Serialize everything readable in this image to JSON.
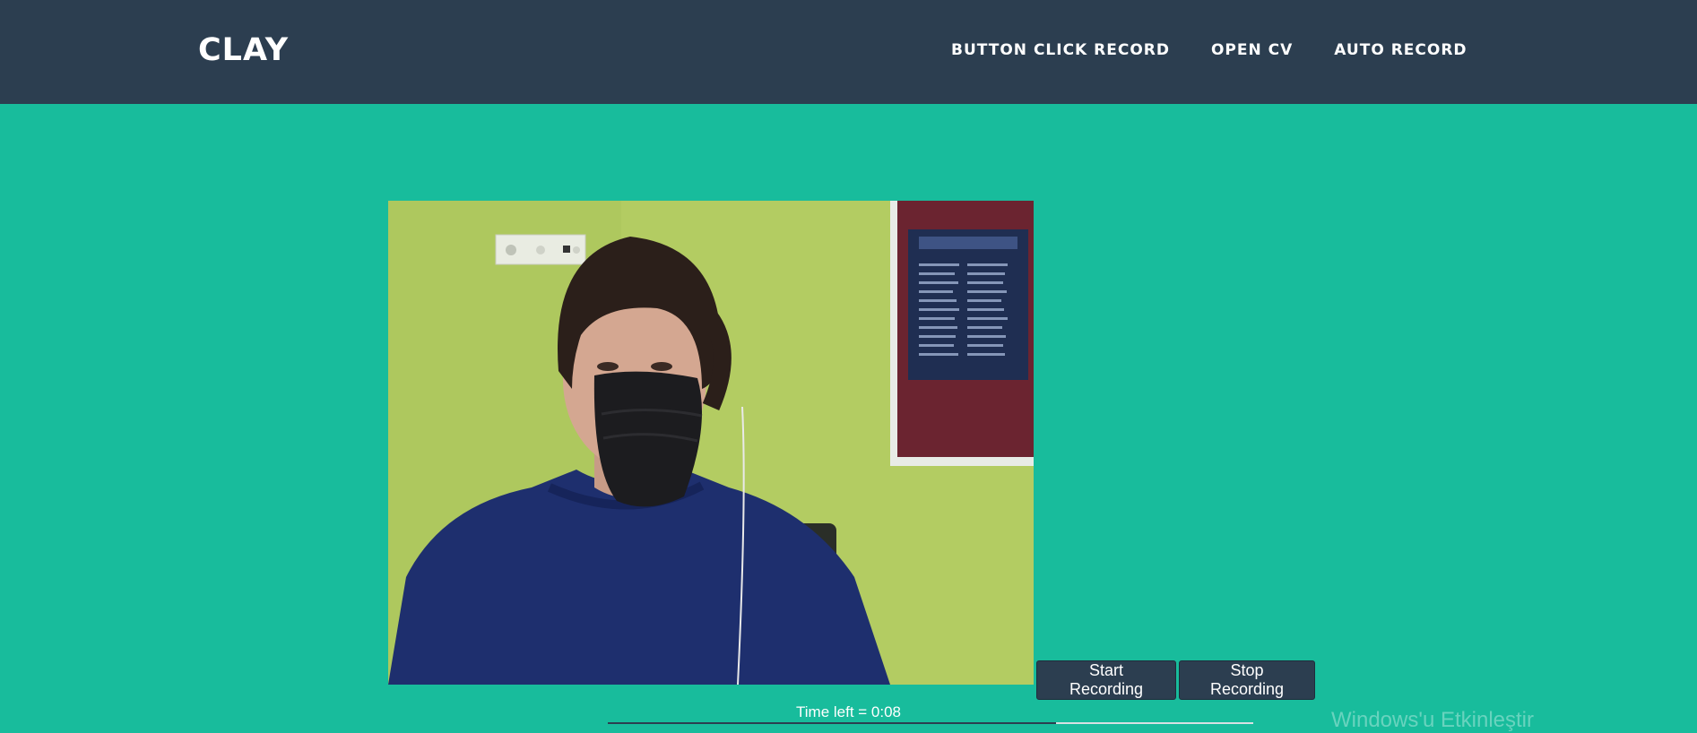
{
  "navbar": {
    "brand": "CLAY",
    "links": [
      {
        "label": "BUTTON CLICK RECORD"
      },
      {
        "label": "OPEN CV"
      },
      {
        "label": "AUTO RECORD"
      }
    ]
  },
  "video": {
    "content": "webcam-feed"
  },
  "controls": {
    "start_label": "Start Recording",
    "stop_label": "Stop Recording"
  },
  "timer": {
    "text": "Time left = 0:08"
  },
  "os_overlay": {
    "watermark": "Windows'u Etkinleştir"
  },
  "colors": {
    "navbar_bg": "#2c3e50",
    "page_bg": "#18bc9c",
    "button_bg": "#2c3e50",
    "text_light": "#ffffff"
  }
}
